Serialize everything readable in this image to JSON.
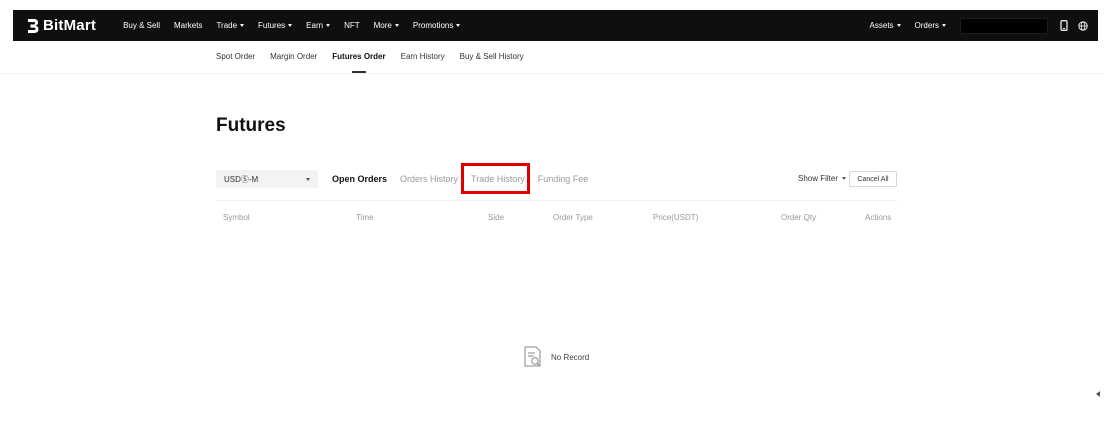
{
  "topnav": {
    "brand": "BitMart",
    "items": [
      {
        "label": "Buy & Sell",
        "dropdown": false
      },
      {
        "label": "Markets",
        "dropdown": false
      },
      {
        "label": "Trade",
        "dropdown": true
      },
      {
        "label": "Futures",
        "dropdown": true
      },
      {
        "label": "Earn",
        "dropdown": true
      },
      {
        "label": "NFT",
        "dropdown": false
      },
      {
        "label": "More",
        "dropdown": true
      },
      {
        "label": "Promotions",
        "dropdown": true
      }
    ],
    "assets_label": "Assets",
    "orders_label": "Orders",
    "icons": [
      "mobile-phone-icon",
      "globe-icon"
    ]
  },
  "subnav": {
    "items": [
      "Spot Order",
      "Margin Order",
      "Futures Order",
      "Earn History",
      "Buy & Sell History"
    ],
    "active": "Futures Order"
  },
  "page": {
    "title": "Futures"
  },
  "filters": {
    "contract_selector": "USDⓈ-M",
    "tabs": [
      "Open Orders",
      "Orders History",
      "Trade History",
      "Funding Fee"
    ],
    "active_tab": "Open Orders",
    "highlighted_tab": "Trade History",
    "show_filter_label": "Show Filter",
    "cancel_all_label": "Cancel All"
  },
  "table": {
    "columns": [
      "Symbol",
      "Time",
      "Side",
      "Order Type",
      "Price(USDT)",
      "Order Qty",
      "Actions"
    ],
    "rows": [],
    "empty_text": "No Record"
  },
  "colors": {
    "topbar_bg": "#0f0f0f",
    "highlight_border": "#e00000",
    "active_text": "#111111",
    "muted_text": "#999999"
  }
}
